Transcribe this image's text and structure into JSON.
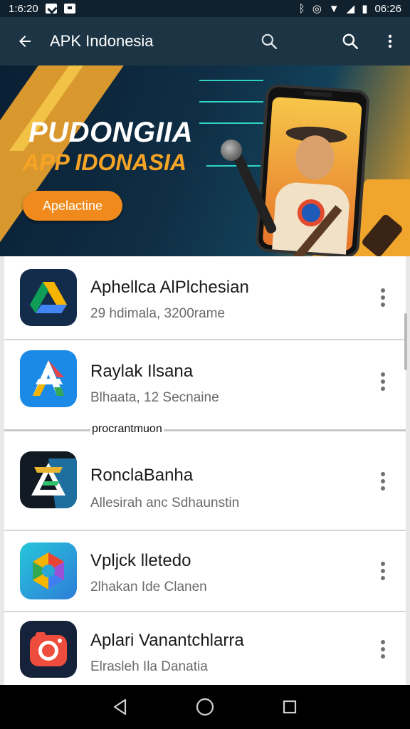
{
  "status_bar": {
    "time_left": "1:6:20",
    "time_right": "06:26"
  },
  "app_bar": {
    "title": "APK Indonesia"
  },
  "banner": {
    "title": "PUDONGIIA",
    "subtitle": "APP IDONASIA",
    "button_label": "Apelactine"
  },
  "apps": [
    {
      "name": "Aphellca AlPlchesian",
      "subtitle": "29 hdimala, 3200rame",
      "icon": "drive-icon"
    },
    {
      "name": "Raylak Ilsana",
      "subtitle": "Blhaata, 12 Secnaine",
      "icon": "a-logo-icon"
    },
    {
      "name": "RonclaBanha",
      "subtitle": "Allesirah anc Sdhaunstin",
      "icon": "delta-logo-icon"
    },
    {
      "name": "Vpljck lletedo",
      "subtitle": "2lhakan Ide Clanen",
      "icon": "hexagon-logo-icon"
    },
    {
      "name": "Aplari Vanantchlarra",
      "subtitle": "Elrasleh Ila Danatia",
      "icon": "camera-icon"
    }
  ],
  "overlay_text": "procrantmuon",
  "colors": {
    "app_bar": "#1c3444",
    "status_bar": "#10202c",
    "accent_orange": "#f08a1c"
  }
}
